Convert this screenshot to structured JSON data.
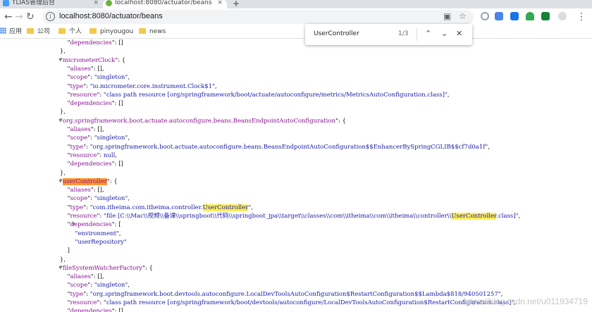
{
  "browser": {
    "tabs": [
      {
        "title": "TLIAS管理后台",
        "active": false
      },
      {
        "title": "localhost:8080/actuator/beans",
        "active": true
      }
    ],
    "new_tab_symbol": "+",
    "close_symbol": "×",
    "url": "localhost:8080/actuator/beans",
    "bookmarks": [
      {
        "label": "应用",
        "icon": "apps-icon"
      },
      {
        "label": "公司",
        "icon": "folder-icon"
      },
      {
        "label": "个人",
        "icon": "folder-icon"
      },
      {
        "label": "pinyougou",
        "icon": "folder-icon"
      },
      {
        "label": "news",
        "icon": "folder-icon"
      }
    ],
    "colors": {
      "highlight": "#ffee58",
      "current_match": "#ff9632",
      "key": "#881391",
      "string": "#1a1aa6"
    }
  },
  "find_bar": {
    "query": "UserController",
    "count": "1/3"
  },
  "json_lines": [
    [
      {
        "t": "        \""
      },
      {
        "t": "dependencies",
        "c": "k"
      },
      {
        "t": "\": []"
      }
    ],
    [
      {
        "t": "    },"
      }
    ],
    [
      {
        "t": "    \""
      },
      {
        "t": "micrometerClock",
        "c": "k"
      },
      {
        "t": "\": {"
      }
    ],
    [
      {
        "t": "        \""
      },
      {
        "t": "aliases",
        "c": "k"
      },
      {
        "t": "\": [],"
      }
    ],
    [
      {
        "t": "        \""
      },
      {
        "t": "scope",
        "c": "k"
      },
      {
        "t": "\": "
      },
      {
        "t": "\"singleton\"",
        "c": "s"
      },
      {
        "t": ","
      }
    ],
    [
      {
        "t": "        \""
      },
      {
        "t": "type",
        "c": "k"
      },
      {
        "t": "\": "
      },
      {
        "t": "\"io.micrometer.core.instrument.Clock$1\"",
        "c": "s"
      },
      {
        "t": ","
      }
    ],
    [
      {
        "t": "        \""
      },
      {
        "t": "resource",
        "c": "k"
      },
      {
        "t": "\": "
      },
      {
        "t": "\"class path resource [org/springframework/boot/actuate/autoconfigure/metrics/MetricsAutoConfiguration.class]\"",
        "c": "s"
      },
      {
        "t": ","
      }
    ],
    [
      {
        "t": "        \""
      },
      {
        "t": "dependencies",
        "c": "k"
      },
      {
        "t": "\": []"
      }
    ],
    [
      {
        "t": "    },"
      }
    ],
    [
      {
        "t": "    \""
      },
      {
        "t": "org.springframework.boot.actuate.autoconfigure.beans.BeansEndpointAutoConfiguration",
        "c": "k"
      },
      {
        "t": "\": {"
      }
    ],
    [
      {
        "t": "        \""
      },
      {
        "t": "aliases",
        "c": "k"
      },
      {
        "t": "\": [],"
      }
    ],
    [
      {
        "t": "        \""
      },
      {
        "t": "scope",
        "c": "k"
      },
      {
        "t": "\": "
      },
      {
        "t": "\"singleton\"",
        "c": "s"
      },
      {
        "t": ","
      }
    ],
    [
      {
        "t": "        \""
      },
      {
        "t": "type",
        "c": "k"
      },
      {
        "t": "\": "
      },
      {
        "t": "\"org.springframework.boot.actuate.autoconfigure.beans.BeansEndpointAutoConfiguration$$EnhancerBySpringCGLIB$$cf7d0a1f\"",
        "c": "s"
      },
      {
        "t": ","
      }
    ],
    [
      {
        "t": "        \""
      },
      {
        "t": "resource",
        "c": "k"
      },
      {
        "t": "\": "
      },
      {
        "t": "null",
        "c": "n"
      },
      {
        "t": ","
      }
    ],
    [
      {
        "t": "        \""
      },
      {
        "t": "dependencies",
        "c": "k"
      },
      {
        "t": "\": []"
      }
    ],
    [
      {
        "t": "    },"
      }
    ],
    [
      {
        "t": "    \""
      },
      {
        "t": "userController",
        "c": "k",
        "h": "hlc"
      },
      {
        "t": "\": {"
      }
    ],
    [
      {
        "t": "        \""
      },
      {
        "t": "aliases",
        "c": "k"
      },
      {
        "t": "\": [],"
      }
    ],
    [
      {
        "t": "        \""
      },
      {
        "t": "scope",
        "c": "k"
      },
      {
        "t": "\": "
      },
      {
        "t": "\"singleton\"",
        "c": "s"
      },
      {
        "t": ","
      }
    ],
    [
      {
        "t": "        \""
      },
      {
        "t": "type",
        "c": "k"
      },
      {
        "t": "\": "
      },
      {
        "t": "\"com.itheima.com.itheima.controller.",
        "c": "s"
      },
      {
        "t": "UserController",
        "c": "s",
        "h": "hl"
      },
      {
        "t": "\"",
        "c": "s"
      },
      {
        "t": ","
      }
    ],
    [
      {
        "t": "        \""
      },
      {
        "t": "resource",
        "c": "k"
      },
      {
        "t": "\": "
      },
      {
        "t": "\"file [C:\\\\Mac\\\\视频\\\\备课\\\\springboot\\\\代码\\\\springboot_jpa\\\\target\\\\classes\\\\com\\\\itheima\\\\com\\\\itheima\\\\controller\\\\",
        "c": "s"
      },
      {
        "t": "UserController",
        "c": "s",
        "h": "hl"
      },
      {
        "t": ".class]\"",
        "c": "s"
      },
      {
        "t": ","
      }
    ],
    [
      {
        "t": "        \""
      },
      {
        "t": "dependencies",
        "c": "k"
      },
      {
        "t": "\": ["
      }
    ],
    [
      {
        "t": "            "
      },
      {
        "t": "\"environment\"",
        "c": "s"
      },
      {
        "t": ","
      }
    ],
    [
      {
        "t": "            "
      },
      {
        "t": "\"userRepository\"",
        "c": "s"
      }
    ],
    [
      {
        "t": "        ]"
      }
    ],
    [
      {
        "t": "    },"
      }
    ],
    [
      {
        "t": "    \""
      },
      {
        "t": "fileSystemWatcherFactory",
        "c": "k"
      },
      {
        "t": "\": {"
      }
    ],
    [
      {
        "t": "        \""
      },
      {
        "t": "aliases",
        "c": "k"
      },
      {
        "t": "\": [],"
      }
    ],
    [
      {
        "t": "        \""
      },
      {
        "t": "scope",
        "c": "k"
      },
      {
        "t": "\": "
      },
      {
        "t": "\"singleton\"",
        "c": "s"
      },
      {
        "t": ","
      }
    ],
    [
      {
        "t": "        \""
      },
      {
        "t": "type",
        "c": "k"
      },
      {
        "t": "\": "
      },
      {
        "t": "\"org.springframework.boot.devtools.autoconfigure.LocalDevToolsAutoConfiguration$RestartConfiguration$$Lambda$818/940501257\"",
        "c": "s"
      },
      {
        "t": ","
      }
    ],
    [
      {
        "t": "        \""
      },
      {
        "t": "resource",
        "c": "k"
      },
      {
        "t": "\": "
      },
      {
        "t": "\"class path resource [org/springframework/boot/devtools/autoconfigure/LocalDevToolsAutoConfiguration$RestartConfiguration.class]\"",
        "c": "s"
      },
      {
        "t": ","
      }
    ],
    [
      {
        "t": "        \""
      },
      {
        "t": "dependencies",
        "c": "k"
      },
      {
        "t": "\": []"
      }
    ]
  ],
  "watermark": "https://blog.csdn.net/u011934719"
}
